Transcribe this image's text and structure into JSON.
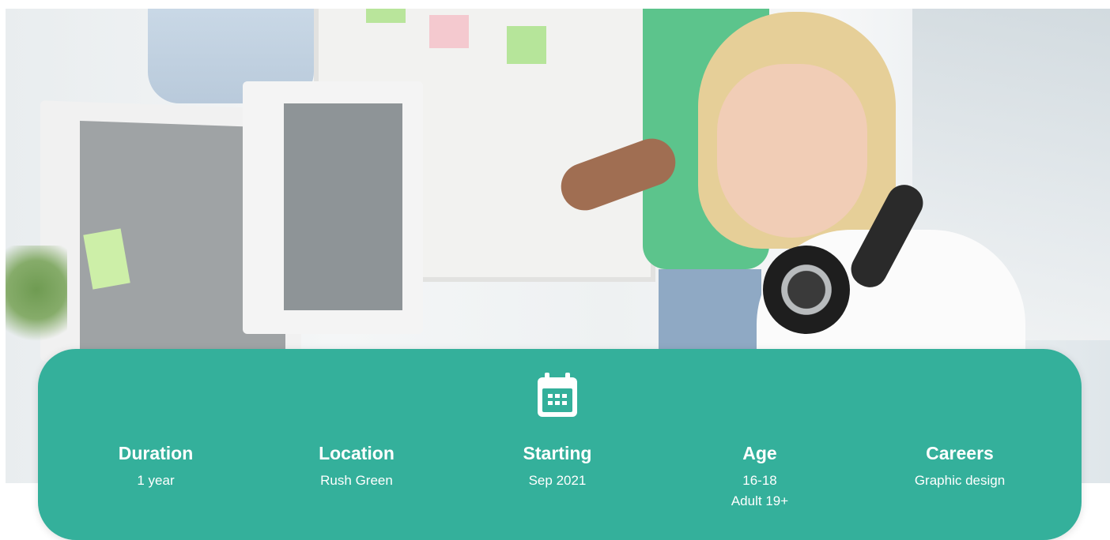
{
  "hero": {
    "image_alt": "Student with headphones at desk in office"
  },
  "info": {
    "icon": "calendar-icon",
    "accent_color": "#34b09b",
    "items": [
      {
        "label": "Duration",
        "values": [
          "1 year"
        ]
      },
      {
        "label": "Location",
        "values": [
          "Rush Green"
        ]
      },
      {
        "label": "Starting",
        "values": [
          "Sep 2021"
        ]
      },
      {
        "label": "Age",
        "values": [
          "16-18",
          "Adult 19+"
        ]
      },
      {
        "label": "Careers",
        "values": [
          "Graphic design"
        ]
      }
    ]
  }
}
